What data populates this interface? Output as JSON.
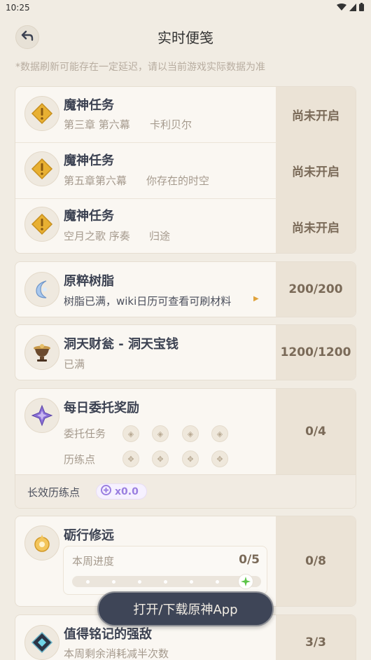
{
  "status": {
    "time": "10:25"
  },
  "header": {
    "title": "实时便笺",
    "note": "*数据刷新可能存在一定延迟，请以当前游戏实际数据为准"
  },
  "quests": [
    {
      "title": "魔神任务",
      "chapter": "第三章 第六幕",
      "name": "卡利贝尔",
      "status": "尚未开启"
    },
    {
      "title": "魔神任务",
      "chapter": "第五章第六幕",
      "name": "你存在的时空",
      "status": "尚未开启"
    },
    {
      "title": "魔神任务",
      "chapter": "空月之歌 序奏",
      "name": "归途",
      "status": "尚未开启"
    }
  ],
  "resin": {
    "title": "原粹树脂",
    "desc": "树脂已满，wiki日历可查看可刷材料",
    "value": "200/200"
  },
  "teapot": {
    "title": "洞天财瓮 - 洞天宝钱",
    "desc": "已满",
    "value": "1200/1200"
  },
  "commissions": {
    "title": "每日委托奖励",
    "task_label": "委托任务",
    "points_label": "历练点",
    "value": "0/4",
    "long_label": "长效历练点",
    "long_value": "x0.0"
  },
  "stride": {
    "title": "砺行修远",
    "progress_label": "本周进度",
    "progress_value": "0/5",
    "progress_fraction": 0.0,
    "value": "0/8"
  },
  "boss": {
    "title": "值得铭记的强敌",
    "desc": "本周剩余消耗减半次数",
    "value": "3/3"
  },
  "cta": {
    "label": "打开/下载原神App"
  }
}
